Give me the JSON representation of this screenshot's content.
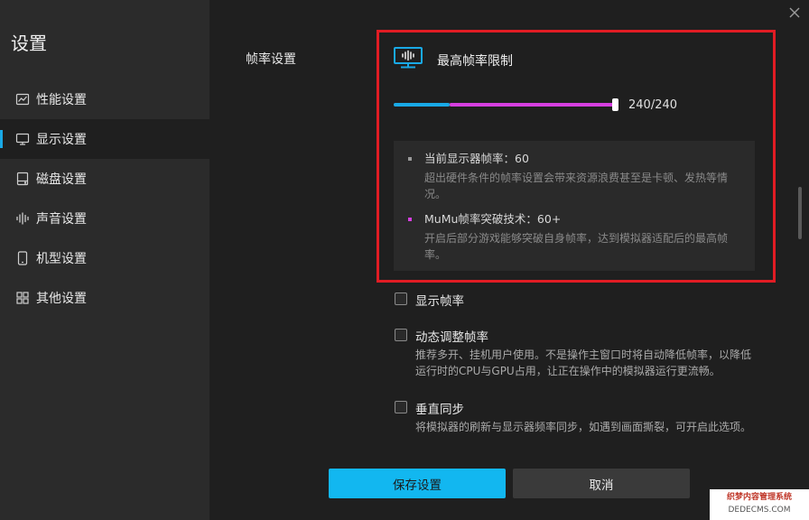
{
  "sidebar": {
    "title": "设置",
    "items": [
      {
        "label": "性能设置",
        "icon": "chart-line-icon",
        "active": false
      },
      {
        "label": "显示设置",
        "icon": "monitor-icon",
        "active": true
      },
      {
        "label": "磁盘设置",
        "icon": "disk-icon",
        "active": false
      },
      {
        "label": "声音设置",
        "icon": "sound-wave-icon",
        "active": false
      },
      {
        "label": "机型设置",
        "icon": "phone-icon",
        "active": false
      },
      {
        "label": "其他设置",
        "icon": "grid-icon",
        "active": false
      }
    ]
  },
  "content": {
    "section_label": "帧率设置",
    "fps_limit": {
      "title": "最高帧率限制",
      "icon": "monitor-fps-icon",
      "value_text": "240/240",
      "value": 240,
      "max": 240,
      "standard_fill_fraction": 0.25
    },
    "info": {
      "item1_title": "当前显示器帧率：60",
      "item1_desc": "超出硬件条件的帧率设置会带来资源浪费甚至是卡顿、发热等情况。",
      "item2_title": "MuMu帧率突破技术：60+",
      "item2_desc": "开启后部分游戏能够突破自身帧率，达到模拟器适配后的最高帧率。"
    },
    "options": {
      "show_fps": {
        "label": "显示帧率",
        "checked": false
      },
      "dynamic_fps": {
        "label": "动态调整帧率",
        "checked": false,
        "desc": "推荐多开、挂机用户使用。不是操作主窗口时将自动降低帧率，以降低运行时的CPU与GPU占用，让正在操作中的模拟器运行更流畅。"
      },
      "vsync": {
        "label": "垂直同步",
        "checked": false,
        "desc": "将模拟器的刷新与显示器频率同步，如遇到画面撕裂，可开启此选项。"
      }
    }
  },
  "buttons": {
    "save_label": "保存设置",
    "cancel_label": "取消"
  },
  "watermark": {
    "line1": "织梦内容管理系统",
    "line2": "DEDECMS.COM"
  },
  "colors": {
    "accent": "#12b7f0",
    "slider_blue": "#19a9e6",
    "slider_pink": "#d63fe0",
    "highlight_border": "#e11c24",
    "bullet_gray": "#9a9a9a",
    "bullet_pink": "#d63fe0"
  }
}
